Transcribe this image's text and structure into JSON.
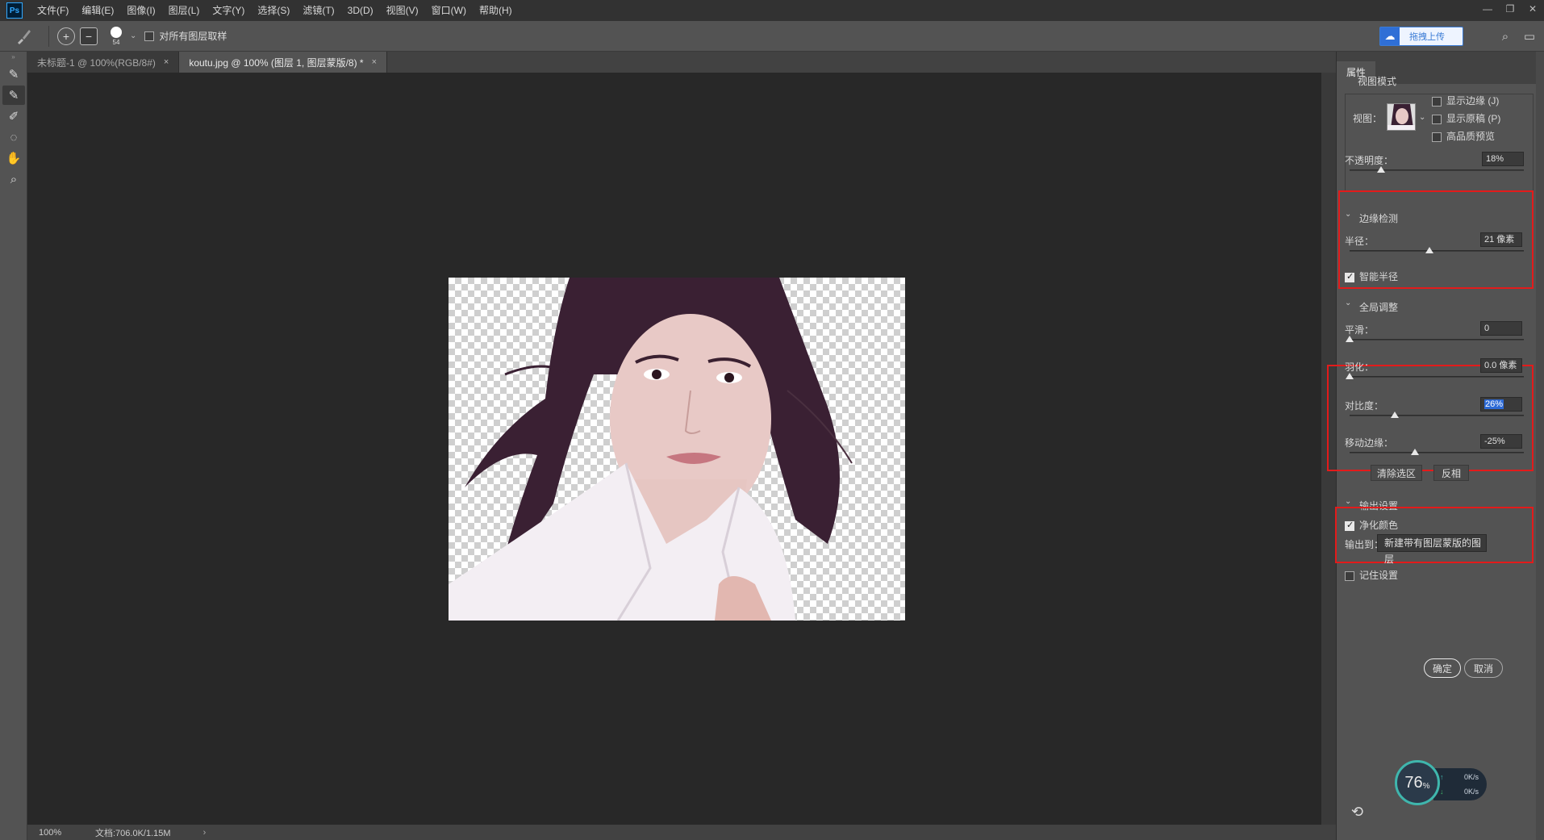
{
  "app": {
    "logo": "Ps"
  },
  "menu": [
    "文件(F)",
    "编辑(E)",
    "图像(I)",
    "图层(L)",
    "文字(Y)",
    "选择(S)",
    "滤镜(T)",
    "3D(D)",
    "视图(V)",
    "窗口(W)",
    "帮助(H)"
  ],
  "options": {
    "brush_size": "54",
    "sample_all_layers_label": "对所有图层取样",
    "upload_label": "拖拽上传"
  },
  "tabs": [
    {
      "label": "未标题-1 @ 100%(RGB/8#)",
      "close": "×"
    },
    {
      "label": "koutu.jpg @ 100% (图层 1, 图层蒙版/8) *",
      "close": "×"
    }
  ],
  "status": {
    "zoom": "100%",
    "doc": "文档:706.0K/1.15M",
    "arrow": "›"
  },
  "panel": {
    "tab": "属性",
    "view_mode": {
      "title": "视图模式",
      "view_label": "视图：",
      "show_edge": "显示边缘 (J)",
      "show_original": "显示原稿 (P)",
      "hq_preview": "高品质预览"
    },
    "opacity": {
      "label": "不透明度：",
      "value": "18%",
      "level": 0.18
    },
    "edge_detection": {
      "title": "边缘检测",
      "radius_label": "半径：",
      "radius_value": "21 像素",
      "radius_level": 0.46,
      "smart_radius": "智能半径"
    },
    "global": {
      "title": "全局调整",
      "smooth_label": "平滑：",
      "smooth_value": "0",
      "smooth_level": 0,
      "feather_label": "羽化：",
      "feather_value": "0.0 像素",
      "feather_level": 0,
      "contrast_label": "对比度：",
      "contrast_value": "26%",
      "contrast_level": 0.26,
      "shift_label": "移动边缘：",
      "shift_value": "-25%",
      "shift_level": 0.375,
      "clear_btn": "清除选区",
      "invert_btn": "反相"
    },
    "output": {
      "title": "输出设置",
      "decontaminate": "净化颜色",
      "output_to_label": "输出到：",
      "output_to_value": "新建带有图层蒙版的图层"
    },
    "remember": "记住设置",
    "ok": "确定",
    "cancel": "取消"
  },
  "speed": {
    "percent": "76",
    "unit": "%",
    "up": "0",
    "down": "0",
    "rate_unit": "K/s"
  },
  "colors": {
    "accent": "#2d6ad6",
    "highlight_box": "#e31b1b",
    "canvas_bg": "#282828"
  }
}
